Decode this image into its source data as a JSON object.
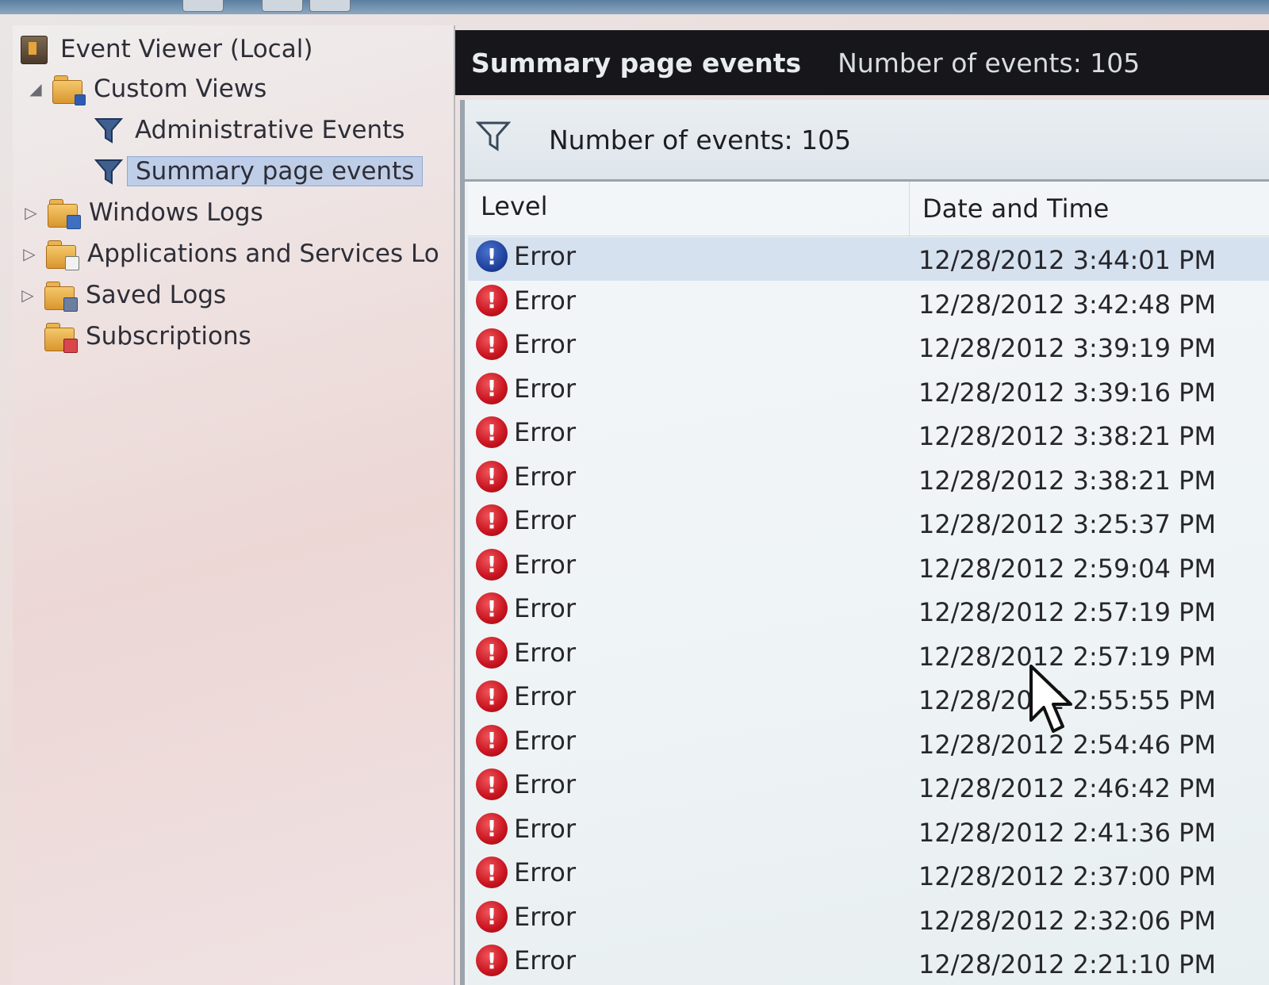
{
  "navigation": {
    "root": "Event Viewer (Local)",
    "custom_views": "Custom Views",
    "administrative_events": "Administrative Events",
    "summary_page_events": "Summary page events",
    "windows_logs": "Windows Logs",
    "applications_services": "Applications and Services Lo",
    "saved_logs": "Saved Logs",
    "subscriptions": "Subscriptions"
  },
  "header": {
    "view_name": "Summary page events",
    "event_count": "Number of events: 105"
  },
  "info_bar": {
    "event_count": "Number of events: 105"
  },
  "table": {
    "columns": {
      "level": "Level",
      "date_time": "Date and Time"
    },
    "rows": [
      {
        "level": "Error",
        "date_time": "12/28/2012 3:44:01 PM"
      },
      {
        "level": "Error",
        "date_time": "12/28/2012 3:42:48 PM"
      },
      {
        "level": "Error",
        "date_time": "12/28/2012 3:39:19 PM"
      },
      {
        "level": "Error",
        "date_time": "12/28/2012 3:39:16 PM"
      },
      {
        "level": "Error",
        "date_time": "12/28/2012 3:38:21 PM"
      },
      {
        "level": "Error",
        "date_time": "12/28/2012 3:38:21 PM"
      },
      {
        "level": "Error",
        "date_time": "12/28/2012 3:25:37 PM"
      },
      {
        "level": "Error",
        "date_time": "12/28/2012 2:59:04 PM"
      },
      {
        "level": "Error",
        "date_time": "12/28/2012 2:57:19 PM"
      },
      {
        "level": "Error",
        "date_time": "12/28/2012 2:57:19 PM"
      },
      {
        "level": "Error",
        "date_time": "12/28/2012 2:55:55 PM"
      },
      {
        "level": "Error",
        "date_time": "12/28/2012 2:54:46 PM"
      },
      {
        "level": "Error",
        "date_time": "12/28/2012 2:46:42 PM"
      },
      {
        "level": "Error",
        "date_time": "12/28/2012 2:41:36 PM"
      },
      {
        "level": "Error",
        "date_time": "12/28/2012 2:37:00 PM"
      },
      {
        "level": "Error",
        "date_time": "12/28/2012 2:32:06 PM"
      },
      {
        "level": "Error",
        "date_time": "12/28/2012 2:21:10 PM"
      }
    ]
  },
  "icons": {
    "error": "error-icon",
    "filter": "funnel-icon",
    "folder": "folder-icon"
  },
  "colors": {
    "title_bar": "#17171b",
    "error_red": "#c8141f",
    "selected_row": "#bed0e8"
  }
}
